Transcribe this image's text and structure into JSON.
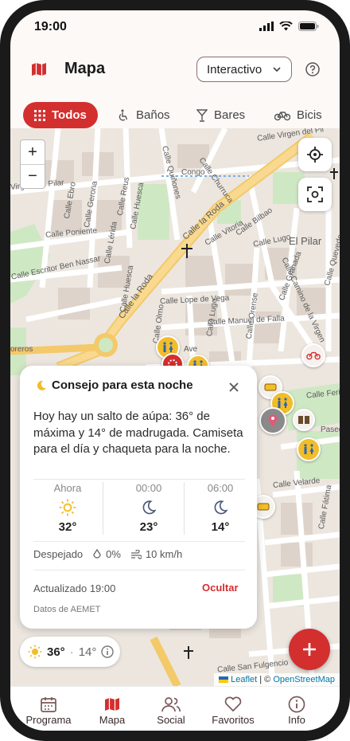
{
  "status_bar": {
    "time": "19:00"
  },
  "header": {
    "title": "Mapa",
    "mode_select": "Interactivo"
  },
  "filters": [
    {
      "label": "Todos",
      "icon": "grid-icon",
      "active": true
    },
    {
      "label": "Baños",
      "icon": "accessible-icon",
      "active": false
    },
    {
      "label": "Bares",
      "icon": "cocktail-icon",
      "active": false
    },
    {
      "label": "Bicis",
      "icon": "bike-icon",
      "active": false
    }
  ],
  "map": {
    "zoom_in": "+",
    "zoom_out": "−",
    "labels": {
      "congo": "Congo",
      "el_pilar": "El Pilar",
      "calle_la_roda_1": "Calle la Roda",
      "calle_la_roda_2": "Calle la Roda",
      "calle_virgen": "Calle Virgen del Pil",
      "virgen_pilar": "Virgen del Pilar",
      "calle_churruca": "Calle Churruca",
      "calle_quinones": "Calle Quiñones",
      "calle_gerona": "Calle Gerona",
      "calle_reus": "Calle Reus",
      "calle_ebro": "Calle Ebro",
      "calle_huesca_1": "Calle Huesca",
      "calle_huesca_2": "Calle Huesca",
      "calle_poniente": "Calle Poniente",
      "calle_escritor": "Calle Escritor Ben Nassar",
      "calle_lerida": "Calle Lérida",
      "calle_vitoria": "Calle Vitoria",
      "calle_bilbao": "Calle Bilbao",
      "calle_lugo": "Calle Lugo",
      "calle_granada": "Calle Granada",
      "calle_camino": "Calle Camino de la Virgen",
      "calle_quevedo": "Calle Quevedo",
      "calle_lope": "Calle Lope de Vega",
      "calle_manuel": "Calle Manuel de Falla",
      "calle_olmo": "Calle Olmo",
      "calle_lugo_2": "Calle Lugo",
      "calle_orense": "Calle Orense",
      "calle_ferial": "Calle Ferial",
      "calle_san_fulgencio": "Calle San Fulgencio",
      "calle_velarde": "Calle Velarde",
      "calle_fatima": "Calle Fátima",
      "paseo": "Paseo",
      "moreros": "oreros",
      "avenida": "Ave"
    },
    "attribution": {
      "leaflet": "Leaflet",
      "separator": " | © ",
      "osm": "OpenStreetMap"
    },
    "weather_pill": {
      "now": "36°",
      "sep": "·",
      "low": "14°"
    }
  },
  "card": {
    "title": "Consejo para esta noche",
    "message": "Hoy hay un salto de aúpa: 36° de máxima y 14° de madrugada. Camiseta para el día y chaqueta para la noche.",
    "forecast": [
      {
        "label": "Ahora",
        "icon": "sun-icon",
        "temp": "32°"
      },
      {
        "label": "00:00",
        "icon": "moon-icon",
        "temp": "23°"
      },
      {
        "label": "06:00",
        "icon": "moon-icon",
        "temp": "14°"
      }
    ],
    "condition": "Despejado",
    "rain": "0%",
    "wind": "10 km/h",
    "updated": "Actualizado 19:00",
    "hide": "Ocultar",
    "source": "Datos de AEMET"
  },
  "nav": [
    {
      "label": "Programa",
      "icon": "calendar-icon",
      "active": false
    },
    {
      "label": "Mapa",
      "icon": "map-icon",
      "active": true
    },
    {
      "label": "Social",
      "icon": "people-icon",
      "active": false
    },
    {
      "label": "Favoritos",
      "icon": "heart-icon",
      "active": false
    },
    {
      "label": "Info",
      "icon": "info-icon",
      "active": false
    }
  ],
  "colors": {
    "accent": "#d32f2f",
    "road_main": "#f4c96a",
    "park": "#cfe8c4",
    "pin_yellow": "#f2bd2a"
  }
}
